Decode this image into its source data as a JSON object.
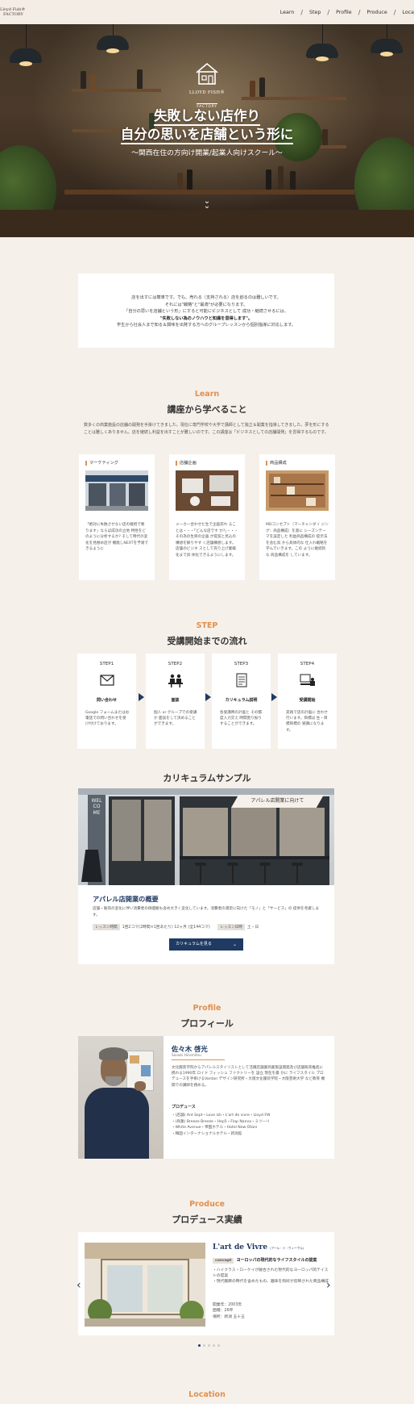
{
  "header": {
    "logo_line1": "Lloyd Fish®",
    "logo_line2": "FACTORY",
    "nav": [
      "Learn",
      "Step",
      "Profile",
      "Produce",
      "Loca"
    ]
  },
  "hero": {
    "logo_name": "LLOYD FISH®",
    "logo_factory": "FACTORY",
    "title_line1": "失敗しない店作り",
    "title_line2": "自分の思いを店舗という形に",
    "subtitle": "〜関西在住の方向け開業/起業人向けスクール〜",
    "scroll_icon": "double-chevron-down"
  },
  "intro": {
    "lines": [
      "店を出すには簡単です。でも、売れる（支持される）店を創るのは難しいです。",
      "それには\"戦略\"と\"最適\"が必要になります。",
      "「自分の思いを店舗という形」にすると可能にビジネスとして 成功・継続させるには、",
      "\"失敗しない為のノウハウと知識を習得します\"。",
      "学生から社会人まで知る＆興味を出発する方へのグループレッスンから個別指導に対応します。"
    ]
  },
  "learn": {
    "en": "Learn",
    "ja": "講座から学べること",
    "desc": "数多くの商業施設の店舗の開発を手掛けてきました。現在に専門学校や大学で講師として独立＆開業を指導してきました。夢を形にすることは難しくありません。店を継続し利益を出すことが難しいのです。この講座は「ビジネスとしての店舗開発」を習得するものです。",
    "cards": [
      {
        "title": "マーケティング",
        "desc": "「絶対に失敗させない店の継続で要ります」ならば成功の立地 特性をどのように分析するか? そして時代の変化を見極め店が 機能しNEXTを予測できるように"
      },
      {
        "title": "店舗企画",
        "desc": "メーカー合わせた生で企画売れ ることは・・・「どんな店です か?」・・・その為の生目の企画 が提案と見込の構想を解りやす く店舗構想します。店舗のビジネ スとして売り上げ業績化まで具 体化できるようにします。"
      },
      {
        "title": "商品構成",
        "desc": "MDコンセプト（マーチャンダイ ジング：商品構成）を基に シーズンテーマを設定した 利益商品構成の 提示法を含む具 から具体的な 仕入れ戦略を 学んでいきます。この ように継続的な 商品構成を しています。"
      }
    ]
  },
  "step": {
    "en": "STEP",
    "ja": "受講開始までの流れ",
    "cards": [
      {
        "num": "STEP1",
        "icon": "envelope-icon",
        "title": "問い合わせ",
        "desc": "Google フォームまたはお電話での問い合わせを受け付けております。"
      },
      {
        "num": "STEP2",
        "icon": "meeting-icon",
        "title": "面談",
        "desc": "個人 or グループでの受講か 面談をして決めることができます。"
      },
      {
        "num": "STEP3",
        "icon": "document-icon",
        "title": "カリキュラム説明",
        "desc": "各受講時の計画と その都度入力交え 時間割り振りすることができます。"
      },
      {
        "num": "STEP4",
        "icon": "presentation-icon",
        "title": "受講開始",
        "desc": "実践で店の計画に 合わせ 行います。目標は 生・目標目標の 受講になります。"
      }
    ]
  },
  "curriculum": {
    "heading": "カリキュラムサンプル",
    "badge": "アパレル店開業に向けて",
    "storefront_sign": "WELCOME",
    "title": "アパレル店開業の概要",
    "desc": "店舗・販売の変化に伴い消費者の価値観も含め大きく変化しています。消費者の満足に向けた「モノ」と「サービス」の 提供を考慮します。",
    "meta_tag1": "レッスン時間",
    "meta_val1": "1回2コマ(2時間×1回あたり) 12ヶ月 (全144コマ)",
    "meta_tag2": "レッスン日時",
    "meta_val2": "土・日",
    "button": "カリキュラムを見る"
  },
  "profile": {
    "en": "Profile",
    "ja": "プロフィール",
    "name": "佐々木 啓光",
    "roman": "Sasaki Hiromitsu",
    "bio": "文化服装学院からアパレルスタイリストとして活躍店舗業商業施設開発及び店舗販売推進に 携わる1990年 ロイド フィッシュ ファクトリーを 設立 現在を最 かに ライフスタイル プロデュースを手掛けるVantan デザイン研究所・大阪文化服装学院・大阪芸術大学 など教育 機関での講師を務める。",
    "produce_heading": "プロデュース",
    "produce_list": [
      "・(店舗) Ant Sept・Love ish・L'art de vivre・Lloyd FW",
      "・(商業) Breeze Breeze・Hep5・Flap Nanva・ミツーリ",
      "・White Avenue・帝国ホテル・Hotel New Otani",
      "・韓国インターナショナルホテル・新潟館"
    ]
  },
  "produce": {
    "en": "Produce",
    "ja": "プロデュース実績",
    "title": "L'art de Vivre",
    "title_small": "(アール・ド・ヴィーヴル)",
    "concept_tag": "concept",
    "concept": "ヨーロッパの現代的なライフスタイルの提案",
    "desc": "・ハイクラス・ローケイが融合された現代的なヨーロッパ的テイストの提案\n・現代服飾の時代を含めたもの、趣味を和好が反映された商品構成",
    "meta": [
      "開業年：2003年",
      "面積：26坪",
      "場所：新潟 五十五"
    ],
    "slide_count": 5,
    "active_slide": 1
  },
  "location": {
    "en": "Location"
  }
}
